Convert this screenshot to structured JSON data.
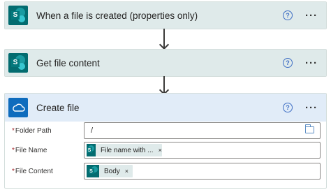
{
  "steps": [
    {
      "title": "When a file is created (properties only)",
      "icon": "sharepoint-icon",
      "help": "?",
      "more": "···"
    },
    {
      "title": "Get file content",
      "icon": "sharepoint-icon",
      "help": "?",
      "more": "···"
    }
  ],
  "create_file": {
    "title": "Create file",
    "icon": "onedrive-icon",
    "help": "?",
    "more": "···",
    "fields": {
      "folder_path": {
        "required_mark": "*",
        "label": "Folder Path",
        "value": "/"
      },
      "file_name": {
        "required_mark": "*",
        "label": "File Name",
        "token": "File name with ...",
        "token_remove": "×"
      },
      "file_content": {
        "required_mark": "*",
        "label": "File Content",
        "token": "Body",
        "token_remove": "×"
      }
    }
  },
  "sharepoint_letter": "S",
  "colors": {
    "sharepoint_header": "#dfeaea",
    "onedrive_header": "#e1ecf8",
    "sharepoint_brand": "#036c70",
    "onedrive_brand": "#0f6cbd"
  }
}
